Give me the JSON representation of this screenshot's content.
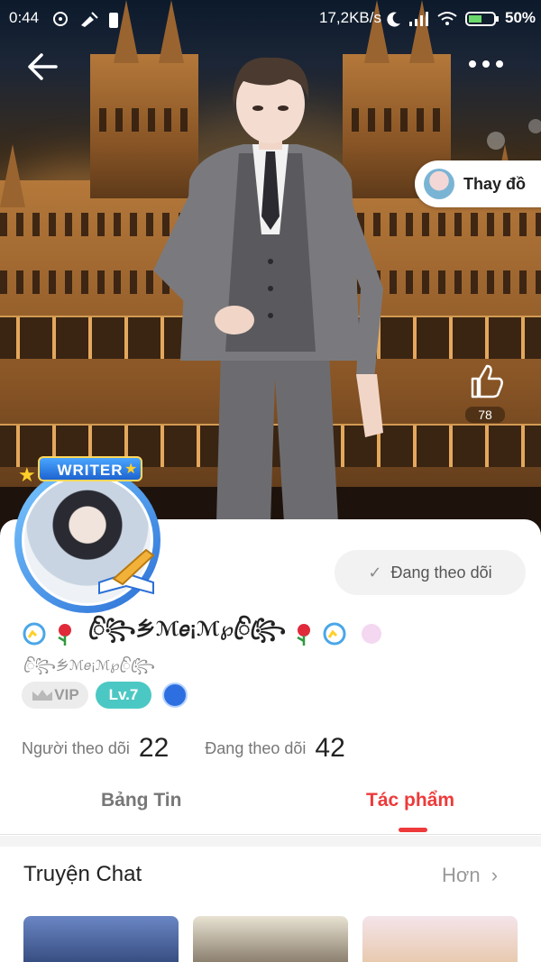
{
  "status_bar": {
    "time": "0:44",
    "network_speed": "17,2KB/s",
    "battery": "50%"
  },
  "hero": {
    "change_outfit_label": "Thay đồ",
    "like_count": "78"
  },
  "profile": {
    "avatar_badge": "WRITER",
    "follow_button_label": "Đang theo dõi",
    "display_name": "ꦿꦼ꧂乡ℳ𝑒¡ℳ℘ꦿꦼ꧂ꦿ",
    "username": "ꦿꦼ꧂乡ℳ𝑒¡ℳ℘ꦿꦼ꧂ꦿ",
    "vip_label": "VIP",
    "level_label": "Lv.7",
    "followers_label": "Người theo dõi",
    "followers_count": "22",
    "following_label": "Đang theo dõi",
    "following_count": "42"
  },
  "tabs": [
    {
      "label": "Bảng Tin",
      "active": false
    },
    {
      "label": "Tác phẩm",
      "active": true
    }
  ],
  "section": {
    "title": "Truyện Chat",
    "more_label": "Hơn"
  },
  "colors": {
    "accent_red": "#ee3a3a",
    "level_teal": "#4cc8c4",
    "writer_blue": "#1d63d0"
  }
}
